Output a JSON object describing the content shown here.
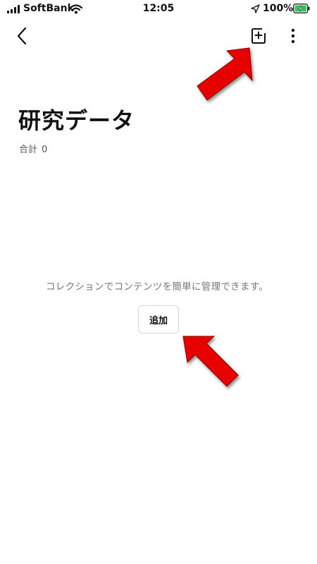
{
  "status_bar": {
    "carrier": "SoftBank",
    "time": "12:05",
    "battery_percent": "100%",
    "signal_icon": "signal-bars-icon",
    "wifi_icon": "wifi-icon",
    "location_icon": "location-arrow-icon",
    "battery_icon": "battery-charging-icon"
  },
  "nav": {
    "back_icon": "chevron-left-icon",
    "add_icon": "add-content-icon",
    "more_icon": "vertical-ellipsis-icon"
  },
  "collection": {
    "title": "研究データ",
    "total_label": "合計",
    "total_count": "0"
  },
  "empty_state": {
    "message": "コレクションでコンテンツを簡単に管理できます。",
    "add_button_label": "追加"
  },
  "colors": {
    "arrow": "#e60000",
    "battery_fill": "#34c759",
    "text_primary": "#111111",
    "text_secondary": "#777777"
  }
}
